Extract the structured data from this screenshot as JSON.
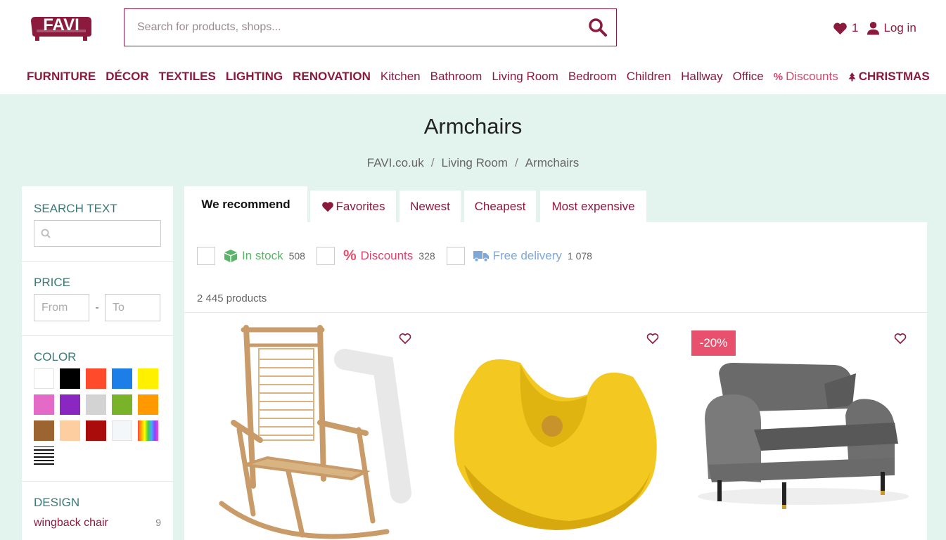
{
  "header": {
    "logo_text": "FAVI",
    "search_placeholder": "Search for products, shops...",
    "favorites_count": "1",
    "login_label": "Log in"
  },
  "nav": {
    "items": [
      "FURNITURE",
      "DÉCOR",
      "TEXTILES",
      "LIGHTING",
      "RENOVATION",
      "Kitchen",
      "Bathroom",
      "Living Room",
      "Bedroom",
      "Children",
      "Hallway",
      "Office",
      "Discounts",
      "CHRISTMAS"
    ]
  },
  "page": {
    "title": "Armchairs",
    "breadcrumb": [
      "FAVI.co.uk",
      "Living Room",
      "Armchairs"
    ],
    "breadcrumb_sep": "/"
  },
  "sidebar": {
    "search_title": "SEARCH TEXT",
    "price_title": "PRICE",
    "price_from_placeholder": "From",
    "price_to_placeholder": "To",
    "price_dash": "-",
    "color_title": "COLOR",
    "colors": [
      "#ffffff",
      "#000000",
      "#ff4b2b",
      "#1e7ee8",
      "#fff000",
      "#e46ac8",
      "#8a27c0",
      "#d3d3d3",
      "#79b32a",
      "#ff9900",
      "#9b6430",
      "#fdcfa0",
      "#aa0c0c",
      "#f3f7fa",
      "rainbow",
      "pattern"
    ],
    "design_title": "DESIGN",
    "design_items": [
      {
        "label": "wingback chair",
        "count": "9"
      }
    ]
  },
  "tabs": [
    "We recommend",
    "Favorites",
    "Newest",
    "Cheapest",
    "Most expensive"
  ],
  "filters": [
    {
      "label": "In stock",
      "count": "508",
      "color": "#5ab56a"
    },
    {
      "label": "Discounts",
      "count": "328",
      "color": "#d7446c"
    },
    {
      "label": "Free delivery",
      "count": "1 078",
      "color": "#7fa8d8"
    }
  ],
  "results": {
    "count_label": "2 445 products"
  },
  "products": [
    {
      "name": "bamboo rocking chair",
      "badge": ""
    },
    {
      "name": "yellow rocking chair",
      "badge": ""
    },
    {
      "name": "grey velvet armchair",
      "badge": "-20%"
    }
  ],
  "colors": {
    "brand": "#8b1a3d",
    "accent_teal": "#3a7a78",
    "background": "#e3f3ee"
  }
}
